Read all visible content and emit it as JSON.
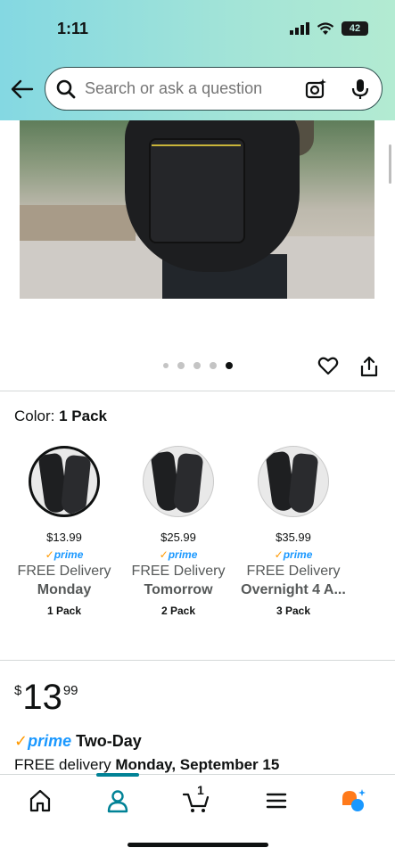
{
  "status_bar": {
    "time": "1:11",
    "battery": "42"
  },
  "search": {
    "placeholder": "Search or ask a question"
  },
  "gallery": {
    "dot_count": 5,
    "active_dot_index": 4
  },
  "color_selector": {
    "label": "Color:",
    "selected": "1 Pack",
    "variants": [
      {
        "price": "$13.99",
        "prime": "prime",
        "delivery": "FREE Delivery",
        "day": "Monday",
        "pack": "1 Pack",
        "selected": true
      },
      {
        "price": "$25.99",
        "prime": "prime",
        "delivery": "FREE Delivery",
        "day": "Tomorrow",
        "pack": "2 Pack",
        "selected": false
      },
      {
        "price": "$35.99",
        "prime": "prime",
        "delivery": "FREE Delivery",
        "day": "Overnight 4 A...",
        "pack": "3 Pack",
        "selected": false
      }
    ]
  },
  "price": {
    "currency": "$",
    "whole": "13",
    "fraction": "99"
  },
  "prime_delivery": {
    "check": "✓",
    "prime": "prime",
    "speed": "Two-Day",
    "free_delivery": "FREE delivery",
    "date": "Monday, September 15"
  },
  "bottom_nav": {
    "cart_count": "1",
    "active_tab": "account"
  },
  "colors": {
    "accent": "#008296",
    "prime_blue": "#1a98ff",
    "prime_check": "#ff9900"
  }
}
